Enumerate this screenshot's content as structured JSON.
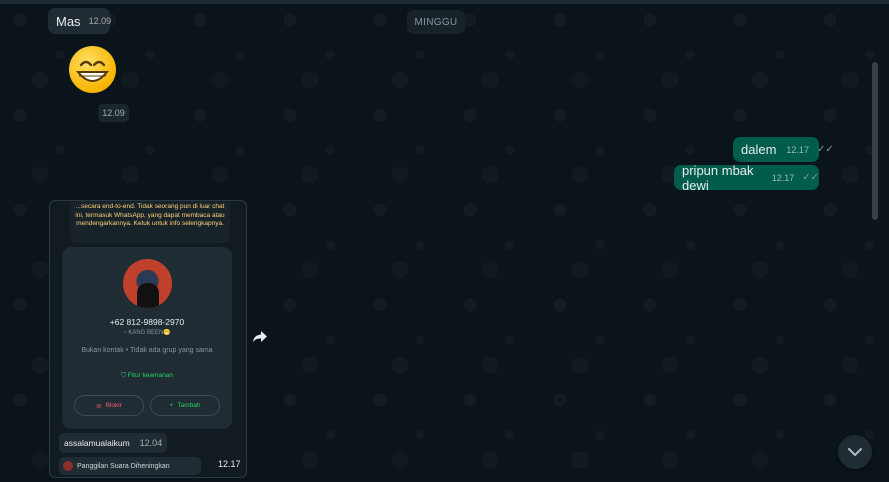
{
  "date_divider": "MINGGU",
  "incoming": {
    "mas": {
      "text": "Mas",
      "time": "12.09"
    },
    "emoji": {
      "glyph": "😁",
      "time": "12.09"
    }
  },
  "outgoing": [
    {
      "text": "dalem",
      "time": "12.17"
    },
    {
      "text": "pripun mbak dewi",
      "time": "12.17"
    }
  ],
  "contact_card": {
    "notice": "...secara end-to-end. Tidak seorang pun di luar chat ini, termasuk WhatsApp, yang dapat membaca atau mendengarkannya. Ketuk untuk info selengkapnya.",
    "phone": "+62 812-9898-2970",
    "alias": "~ KANG BEEN😁",
    "meta": "Bukan kontak • Tidak ada grup yang sama",
    "security_label": "Fitur keamanan",
    "block_label": "Blokir",
    "add_label": "Tambah",
    "greeting": {
      "text": "assalamualaikum",
      "time": "12.04"
    },
    "call_label": "Panggilan Suara Diheningkan",
    "time": "12.17"
  },
  "icons": {
    "forward": "forward-icon",
    "scroll": "chevron-down-icon",
    "ticks": "double-check-icon"
  },
  "colors": {
    "outgoing_bubble": "#005c4b",
    "incoming_bubble": "#202c33",
    "accent_green": "#25d366",
    "block_red": "#f15c6d"
  }
}
